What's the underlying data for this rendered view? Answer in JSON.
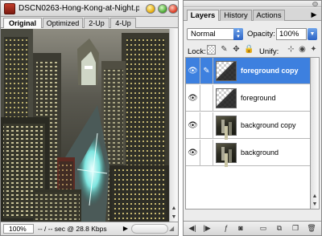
{
  "document": {
    "title": "DSCN0263-Hong-Kong-at-Night.p...",
    "tabs": [
      "Original",
      "Optimized",
      "2-Up",
      "4-Up"
    ],
    "zoom": "100%",
    "status": "-- / -- sec @ 28.8 Kbps",
    "status_menu_icon": "triangle-right"
  },
  "panel": {
    "tabs": [
      "Layers",
      "History",
      "Actions"
    ],
    "menu_icon": "triangle-right",
    "blend_mode": "Normal",
    "opacity_label": "Opacity:",
    "opacity_value": "100%",
    "lock_label": "Lock:",
    "unify_label": "Unify:",
    "layers": [
      {
        "name": "foreground copy",
        "selected": true,
        "visible": true,
        "thumb": "foreground"
      },
      {
        "name": "foreground",
        "selected": false,
        "visible": true,
        "thumb": "foreground"
      },
      {
        "name": "background copy",
        "selected": false,
        "visible": true,
        "thumb": "background"
      },
      {
        "name": "background",
        "selected": false,
        "visible": true,
        "thumb": "background"
      }
    ]
  },
  "colors": {
    "selection": "#3d80df",
    "select_arrow": "#2c63c4"
  }
}
